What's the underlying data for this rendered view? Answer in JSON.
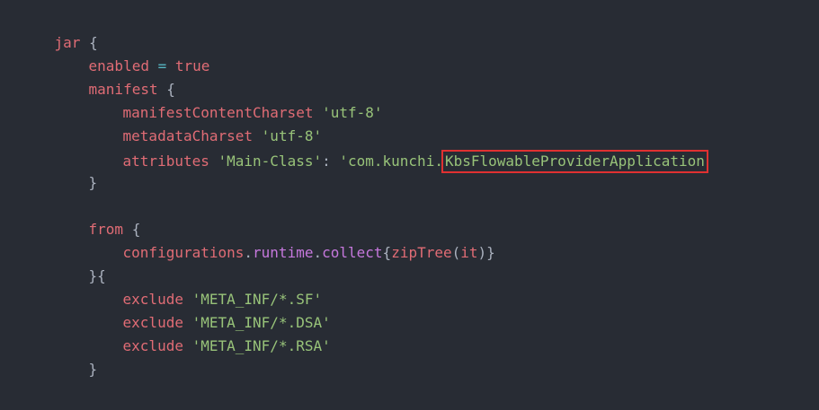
{
  "lines": {
    "l1": {
      "kw": "jar",
      "punc": " {"
    },
    "l2": {
      "kw": "enabled",
      "op": " = ",
      "val": "true"
    },
    "l3": {
      "kw": "manifest",
      "punc": " {"
    },
    "l4": {
      "kw": "manifestContentCharset",
      "space": " ",
      "str": "'utf-8'"
    },
    "l5": {
      "kw": "metadataCharset",
      "space": " ",
      "str": "'utf-8'"
    },
    "l6": {
      "kw": "attributes",
      "space": " ",
      "str1": "'Main-Class'",
      "punc": ": ",
      "str2": "'com.kunchi.",
      "highlighted": "KbsFlowableProviderApplication"
    },
    "l7": {
      "punc": "}"
    },
    "l9": {
      "kw": "from",
      "punc": " {"
    },
    "l10": {
      "kw1": "configurations",
      "dot1": ".",
      "kw2": "runtime",
      "dot2": ".",
      "fn": "collect",
      "brace1": "{",
      "kw3": "zipTree",
      "paren1": "(",
      "kw4": "it",
      "paren2": ")",
      "brace2": "}"
    },
    "l11": {
      "punc": "}{"
    },
    "l12": {
      "kw": "exclude",
      "space": " ",
      "str": "'META_INF/*.SF'"
    },
    "l13": {
      "kw": "exclude",
      "space": " ",
      "str": "'META_INF/*.DSA'"
    },
    "l14": {
      "kw": "exclude",
      "space": " ",
      "str": "'META_INF/*.RSA'"
    },
    "l15": {
      "punc": "}"
    },
    "l17": {
      "punc": "}"
    }
  }
}
